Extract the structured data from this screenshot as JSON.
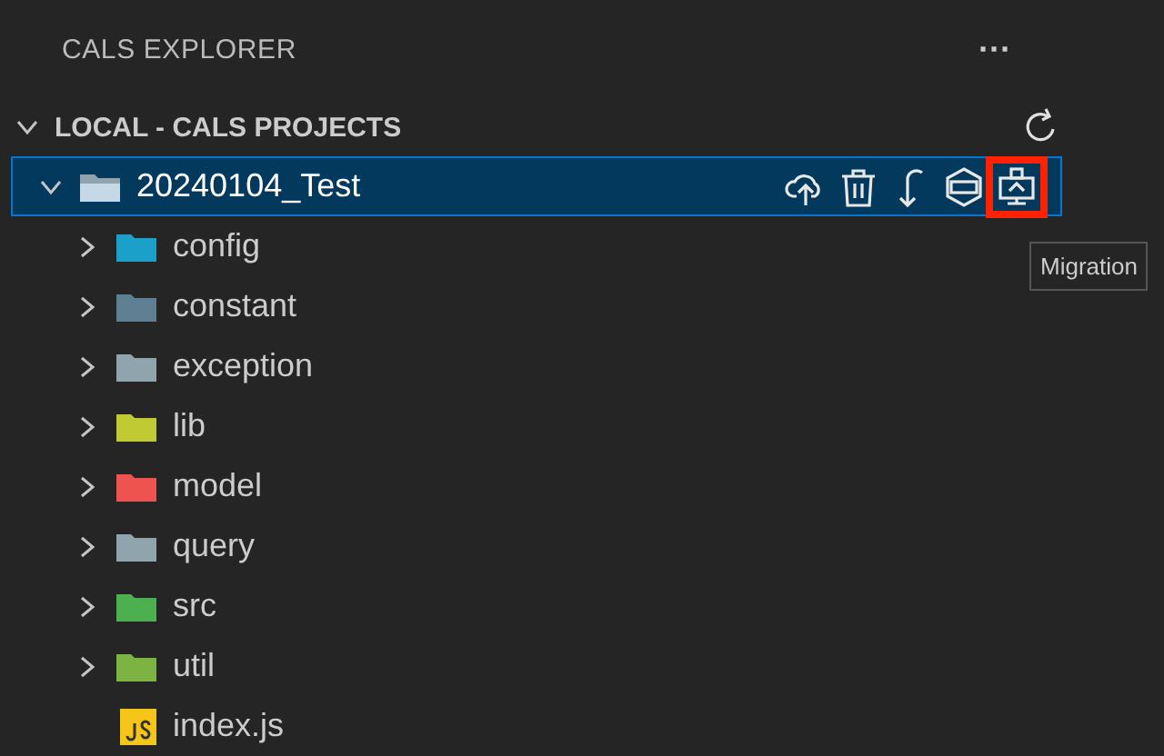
{
  "panel": {
    "title": "CALS EXPLORER",
    "more": "···"
  },
  "section": {
    "label": "LOCAL - CALS PROJECTS",
    "expanded": true
  },
  "project": {
    "label": "20240104_Test",
    "expanded": true,
    "selected": true,
    "actions": [
      {
        "kind": "upload",
        "highlighted": false
      },
      {
        "kind": "delete",
        "highlighted": false
      },
      {
        "kind": "pull",
        "highlighted": false
      },
      {
        "kind": "sdk",
        "highlighted": false
      },
      {
        "kind": "migration",
        "highlighted": true
      }
    ]
  },
  "tooltip": "Migration",
  "children": [
    {
      "kind": "folder",
      "label": "config",
      "color": "#1ba1c9",
      "expanded": false
    },
    {
      "kind": "folder",
      "label": "constant",
      "color": "#5f7f93",
      "expanded": false
    },
    {
      "kind": "folder",
      "label": "exception",
      "color": "#90a4ae",
      "expanded": false
    },
    {
      "kind": "folder",
      "label": "lib",
      "color": "#c0ca33",
      "expanded": false
    },
    {
      "kind": "folder",
      "label": "model",
      "color": "#ef5350",
      "expanded": false
    },
    {
      "kind": "folder",
      "label": "query",
      "color": "#90a4ae",
      "expanded": false
    },
    {
      "kind": "folder",
      "label": "src",
      "color": "#4caf50",
      "expanded": false
    },
    {
      "kind": "folder",
      "label": "util",
      "color": "#7cb342",
      "expanded": false
    },
    {
      "kind": "file",
      "label": "index.js",
      "color": "#f5c518"
    }
  ]
}
